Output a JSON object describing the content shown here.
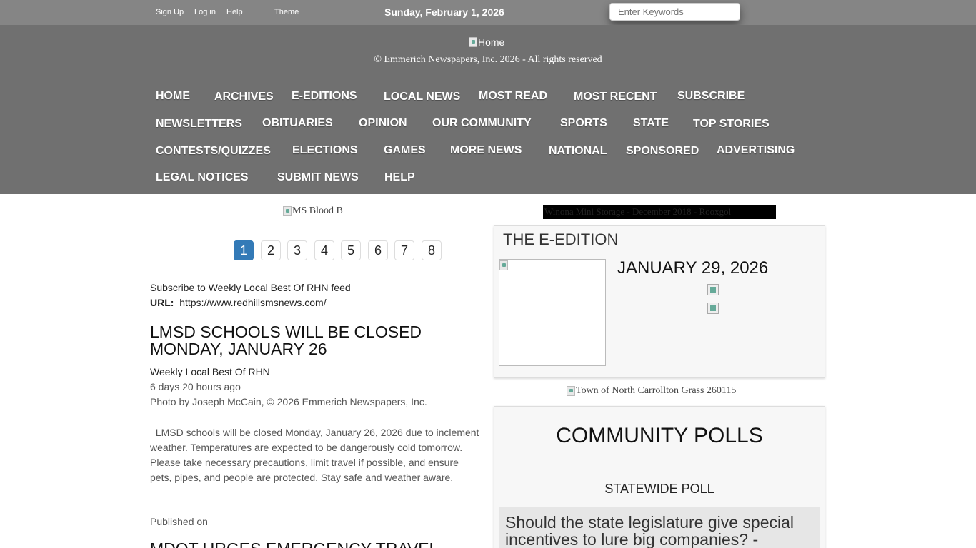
{
  "topbar": {
    "signup": "Sign Up",
    "login": "Log in",
    "help": "Help",
    "theme": "Theme",
    "date": "Sunday, February 1, 2026",
    "search_placeholder": "Enter Keywords"
  },
  "header": {
    "home_logo_alt": "Home",
    "copyright": "© Emmerich Newspapers, Inc. 2026 - All rights reserved"
  },
  "nav": [
    "Home",
    "Archives",
    "E-Editions",
    "Local News",
    "Most Read",
    "Most Recent",
    "Subscribe",
    "Newsletters",
    "Obituaries",
    "Opinion",
    "Our Community",
    "Sports",
    "State",
    "Top Stories",
    "Contests/Quizzes",
    "Elections",
    "Games",
    "More News",
    "National",
    "Sponsored",
    "Advertising",
    "Legal Notices",
    "Submit News",
    "Help"
  ],
  "ads": {
    "left": "MS Blood B",
    "right": "Winona Mini Storage - December 2018 - Rooxgol",
    "middle": "Town of North Carrollton Grass 260115"
  },
  "pagination": {
    "pages": [
      "1",
      "2",
      "3",
      "4",
      "5",
      "6",
      "7",
      "8"
    ],
    "active": "1"
  },
  "feed": {
    "subscribe_text": "Subscribe to Weekly Local Best Of RHN feed",
    "url_label": "URL:",
    "url": "https://www.redhillsmsnews.com/"
  },
  "article": {
    "title": "LMSD Schools will be closed Monday, January 26",
    "source": "Weekly Local Best Of RHN",
    "age": "6 days 20 hours ago",
    "photo_credit": "Photo by Joseph McCain, © 2026 Emmerich Newspapers, Inc.",
    "body": "  LMSD schools will be closed Monday, January 26, 2026 due to inclement weather. Temperatures are expected to be dangerously cold tomorrow. Please take necessary precautions, limit travel if possible, and ensure pets, pipes, and people are protected. Stay safe and weather aware.",
    "published_label": "Published on",
    "next_title": "MDOT urges emergency travel"
  },
  "eedition": {
    "title": "The E-Edition",
    "date": "January 29, 2026"
  },
  "polls": {
    "title": "Community Polls",
    "subtitle": "Statewide Poll",
    "question": "Should the state legislature give special incentives to lure big companies? -"
  }
}
